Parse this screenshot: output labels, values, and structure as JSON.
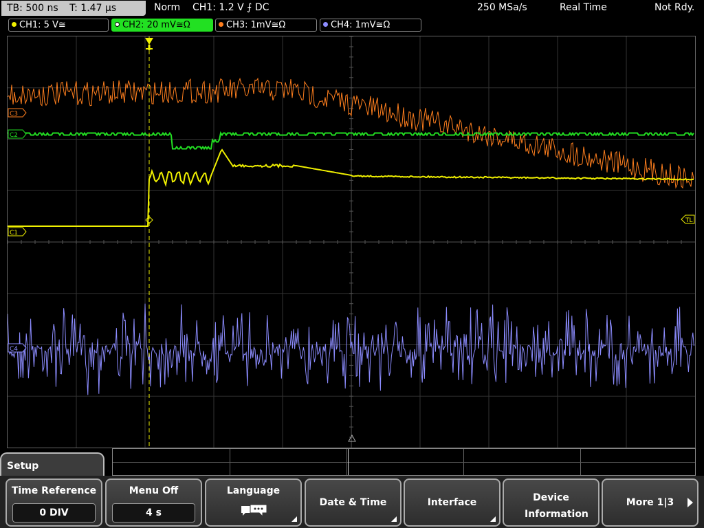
{
  "status": {
    "timebase": "TB: 500 ns",
    "trigger_time": "T: 1.47 µs",
    "mode": "Norm",
    "trigger": "CH1: 1.2 V ⨍ DC",
    "sample_rate": "250 MSa/s",
    "acq_mode": "Real Time",
    "state": "Not Rdy."
  },
  "channels": [
    {
      "label": "CH1: 5 V≅",
      "color": "#f0f000"
    },
    {
      "label": "CH2: 20 mV≅Ω",
      "color": "#22e022"
    },
    {
      "label": "CH3: 1mV≅Ω",
      "color": "#ff7f1e"
    },
    {
      "label": "CH4: 1mV≅Ω",
      "color": "#8c8cff"
    }
  ],
  "markers": {
    "c3": "C3",
    "c2": "C2",
    "c1": "C1",
    "c4": "C4",
    "trigger_level": "TL"
  },
  "menu": {
    "title": "Setup",
    "softkeys": [
      {
        "label": "Time Reference",
        "value": "0 DIV"
      },
      {
        "label": "Menu Off",
        "value": "4 s"
      },
      {
        "label": "Language",
        "icon": "speech-bubbles-icon"
      },
      {
        "label": "Date & Time"
      },
      {
        "label": "Interface"
      },
      {
        "label": "Device Information"
      },
      {
        "label": "More 1|3"
      }
    ]
  }
}
